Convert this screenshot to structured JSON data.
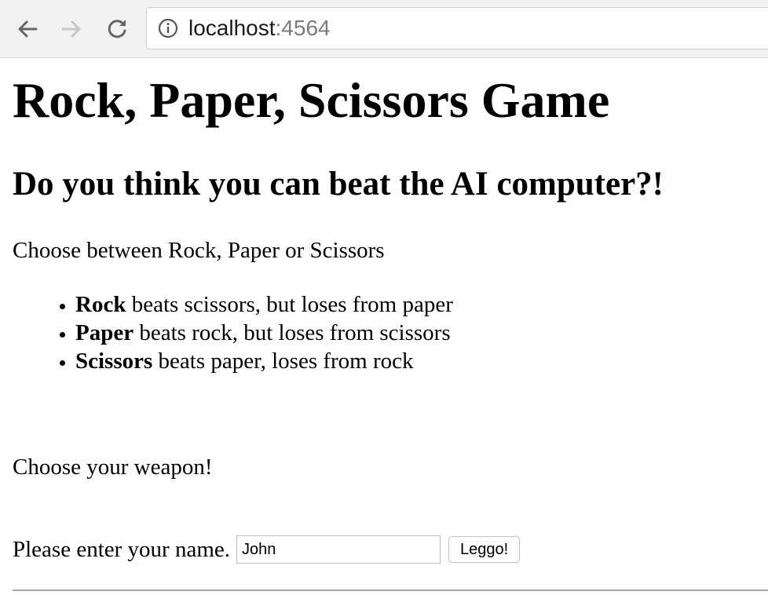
{
  "browser": {
    "url_host": "localhost",
    "url_port": ":4564",
    "icons": {
      "back": "back-arrow-icon",
      "forward": "forward-arrow-icon",
      "reload": "reload-icon",
      "info": "info-icon"
    }
  },
  "page": {
    "title": "Rock, Paper, Scissors Game",
    "subtitle": "Do you think you can beat the AI computer?!",
    "intro": "Choose between Rock, Paper or Scissors",
    "rules": [
      {
        "name": "Rock",
        "text": " beats scissors, but loses from paper"
      },
      {
        "name": "Paper",
        "text": " beats rock, but loses from scissors"
      },
      {
        "name": "Scissors",
        "text": " beats paper, loses from rock"
      }
    ],
    "weapon_prompt": "Choose your weapon!",
    "name_label": "Please enter your name.",
    "name_value": "John",
    "submit_label": "Leggo!"
  }
}
